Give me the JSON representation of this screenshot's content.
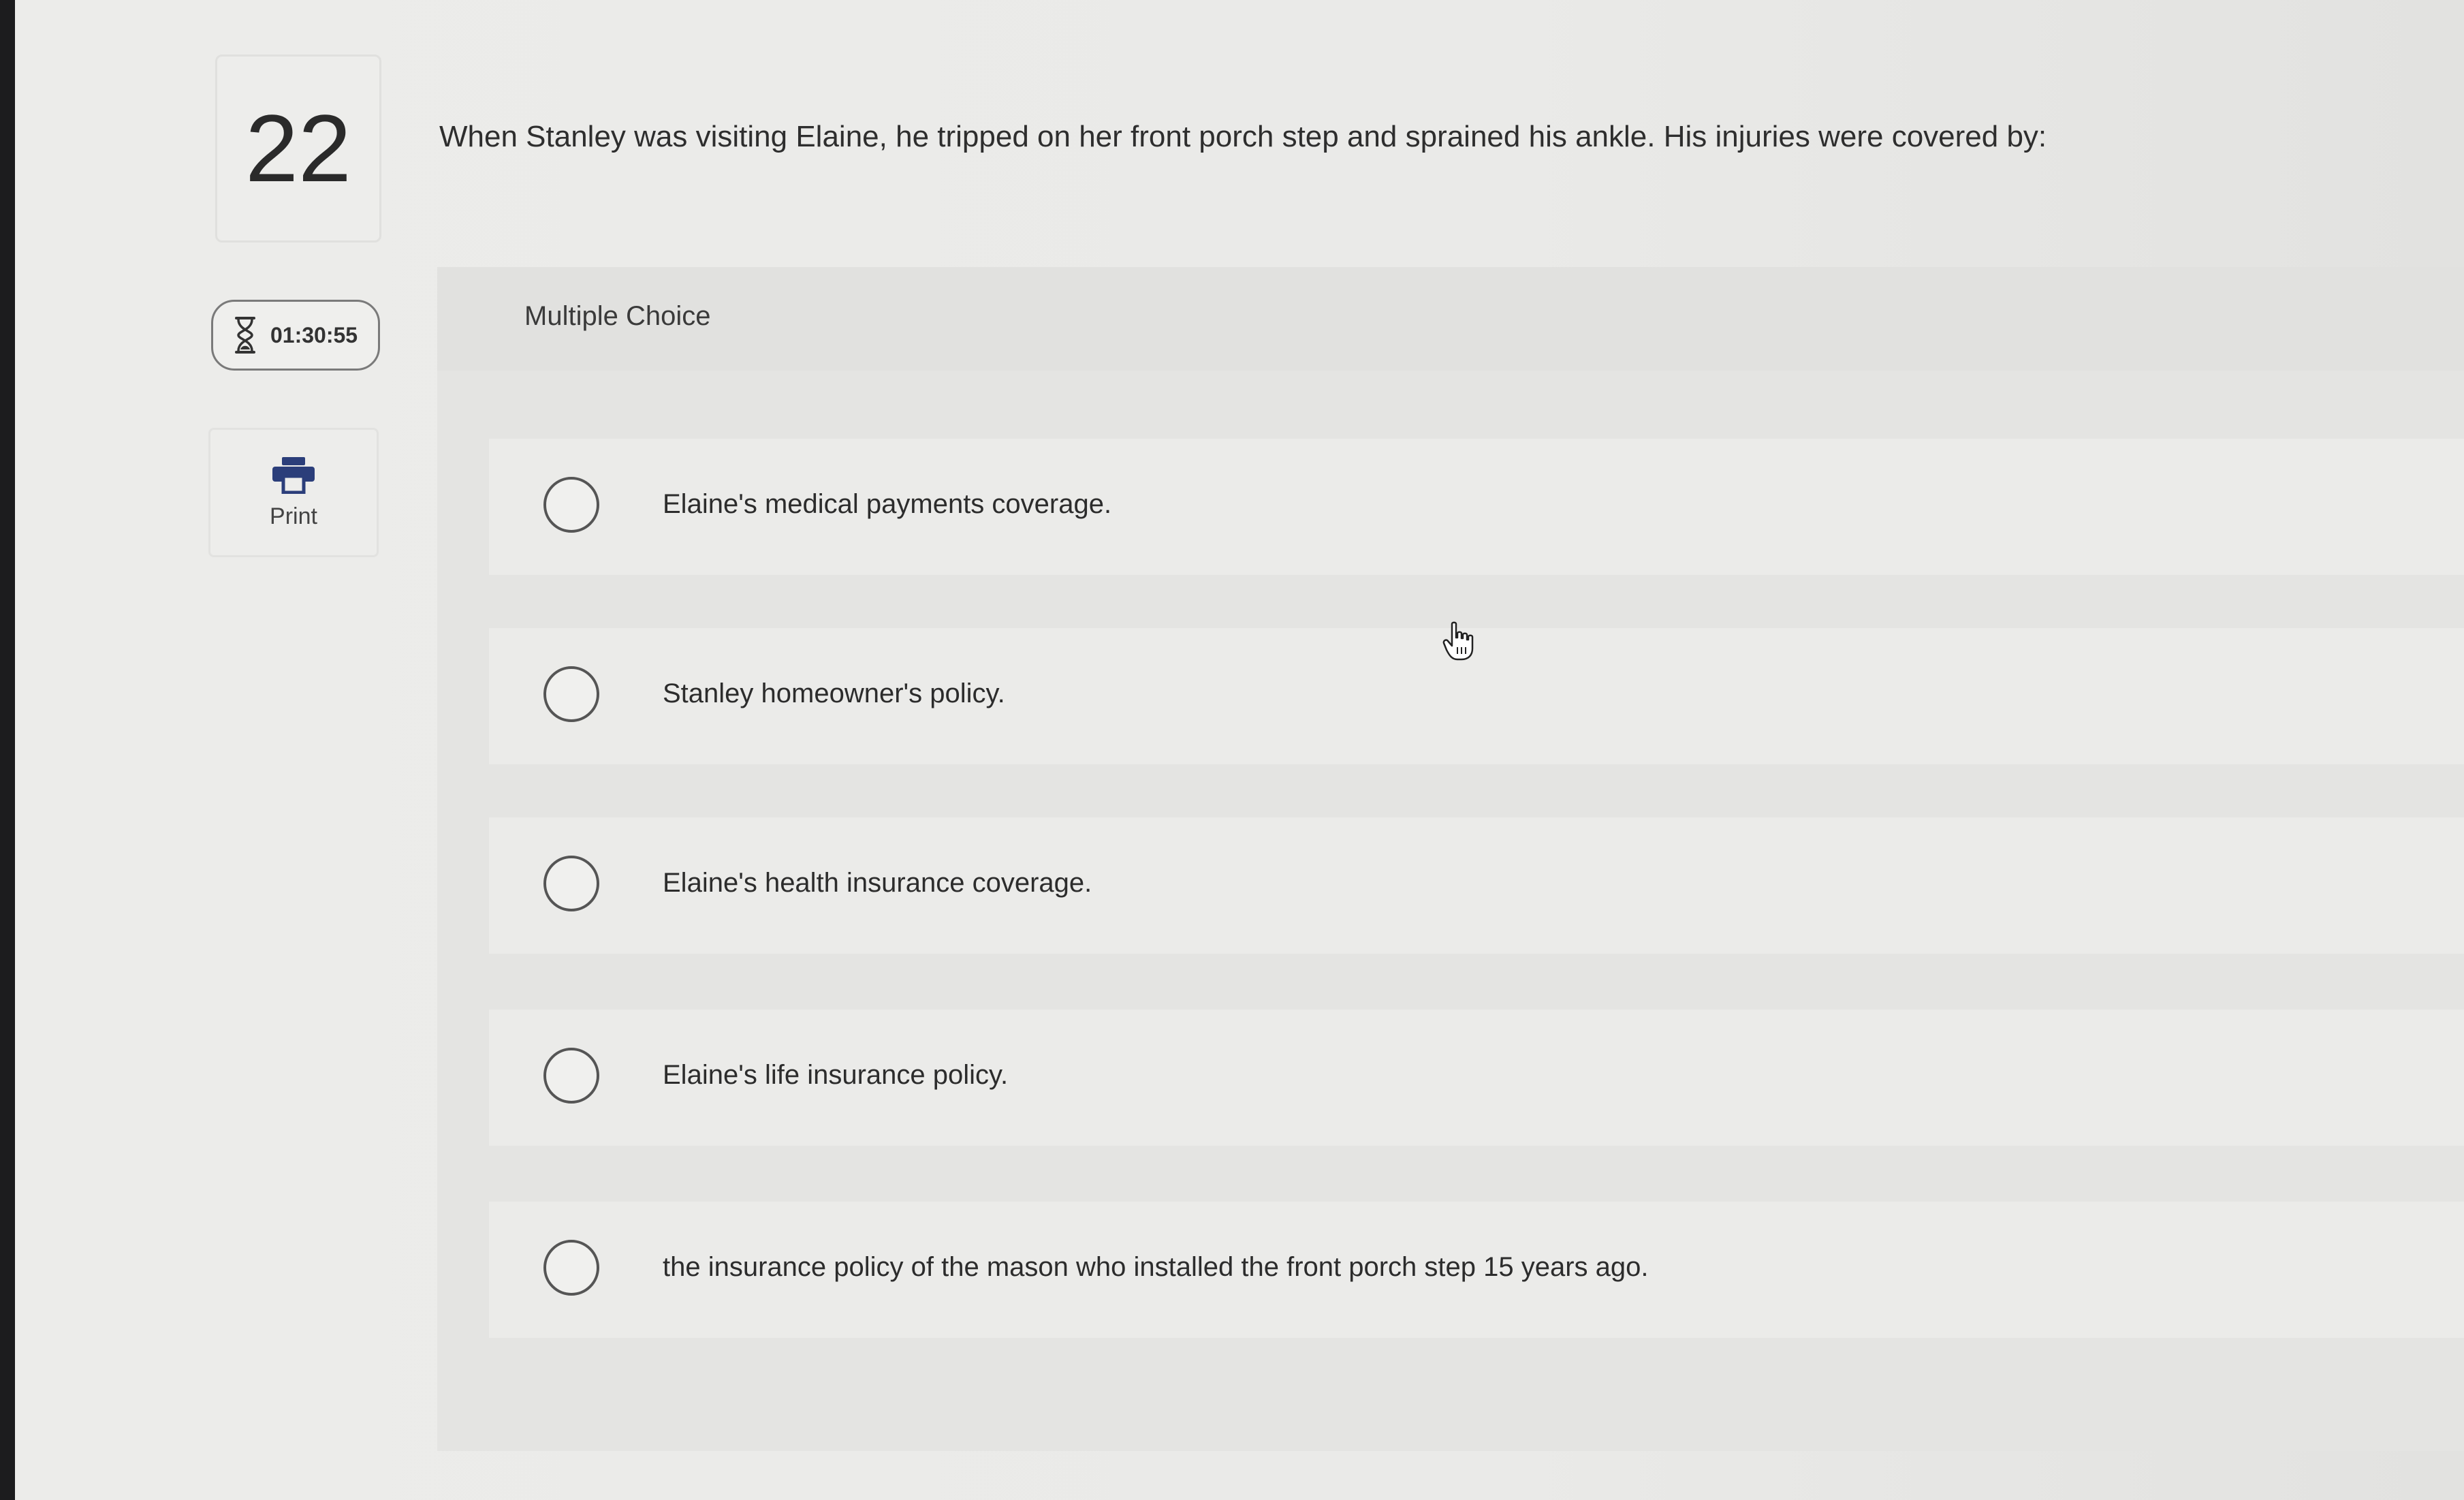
{
  "question": {
    "number": "22",
    "text": "When Stanley was visiting Elaine, he tripped on her front porch step and sprained his ankle. His injuries were covered by:"
  },
  "timer": {
    "icon": "hourglass-icon",
    "value": "01:30:55"
  },
  "print": {
    "icon": "printer-icon",
    "label": "Print",
    "icon_color": "#2b3e7a"
  },
  "answer_panel": {
    "type_label": "Multiple Choice",
    "options": [
      {
        "label": "Elaine's medical payments coverage."
      },
      {
        "label": "Stanley homeowner's policy."
      },
      {
        "label": "Elaine's health insurance coverage."
      },
      {
        "label": "Elaine's life insurance policy."
      },
      {
        "label": "the insurance policy of the mason who installed the front porch step 15 years ago."
      }
    ]
  },
  "cursor": {
    "icon": "hand-pointer-icon"
  }
}
